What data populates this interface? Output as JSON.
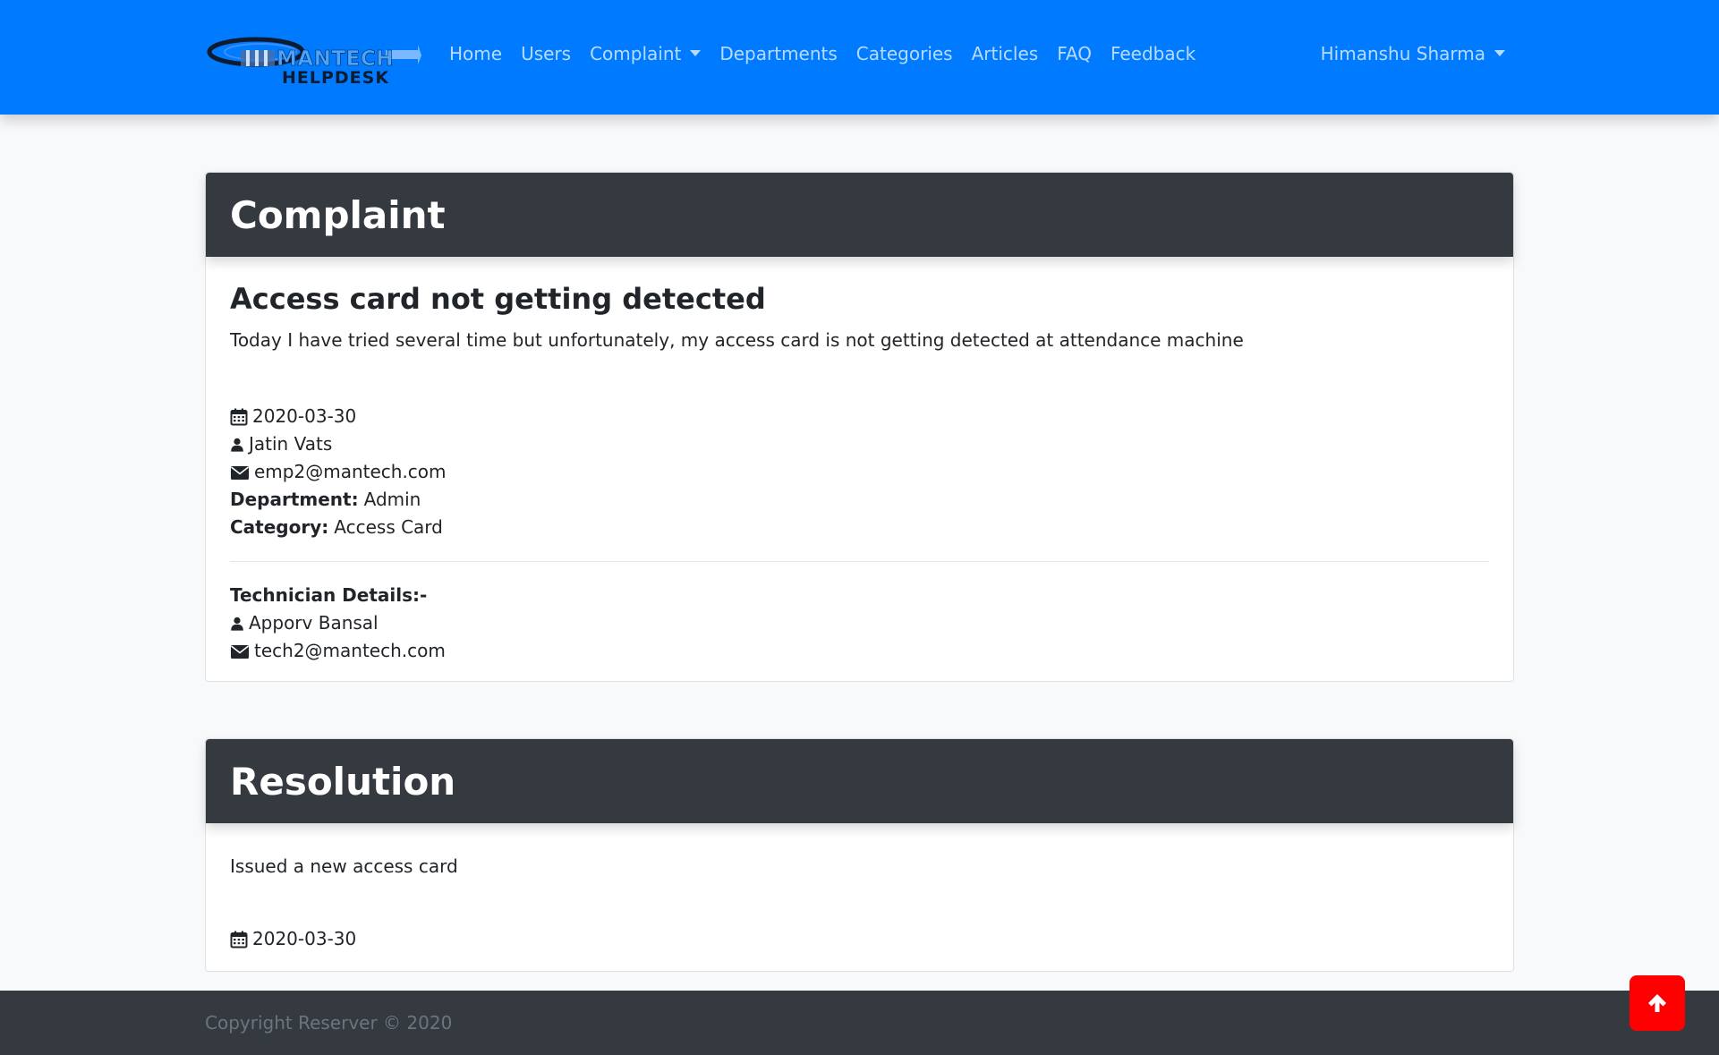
{
  "brand": {
    "line1": "MANTECH",
    "line2": "HELPDESK"
  },
  "nav": {
    "items": [
      {
        "label": "Home"
      },
      {
        "label": "Users"
      },
      {
        "label": "Complaint",
        "dropdown": true
      },
      {
        "label": "Departments"
      },
      {
        "label": "Categories"
      },
      {
        "label": "Articles"
      },
      {
        "label": "FAQ"
      },
      {
        "label": "Feedback"
      }
    ],
    "user": "Himanshu Sharma"
  },
  "complaint": {
    "header": "Complaint",
    "title": "Access card not getting detected",
    "description": "Today I have tried several time but unfortunately, my access card is not getting detected at attendance machine",
    "date": "2020-03-30",
    "employee_name": "Jatin Vats",
    "employee_email": "emp2@mantech.com",
    "department_label": "Department:",
    "department": "Admin",
    "category_label": "Category:",
    "category": "Access Card",
    "technician_heading": "Technician Details:-",
    "technician_name": "Apporv Bansal",
    "technician_email": "tech2@mantech.com"
  },
  "resolution": {
    "header": "Resolution",
    "text": "Issued a new access card",
    "date": "2020-03-30"
  },
  "footer": {
    "copyright": "Copyright Reserver © 2020"
  },
  "icons": {
    "calendar": "calendar-icon",
    "user": "user-icon",
    "envelope": "envelope-icon",
    "scroll_top": "arrow-up-icon"
  },
  "colors": {
    "navbar": "#007bff",
    "card_header": "#343a40",
    "footer": "#343a40",
    "scroll_top": "#ff0000"
  }
}
